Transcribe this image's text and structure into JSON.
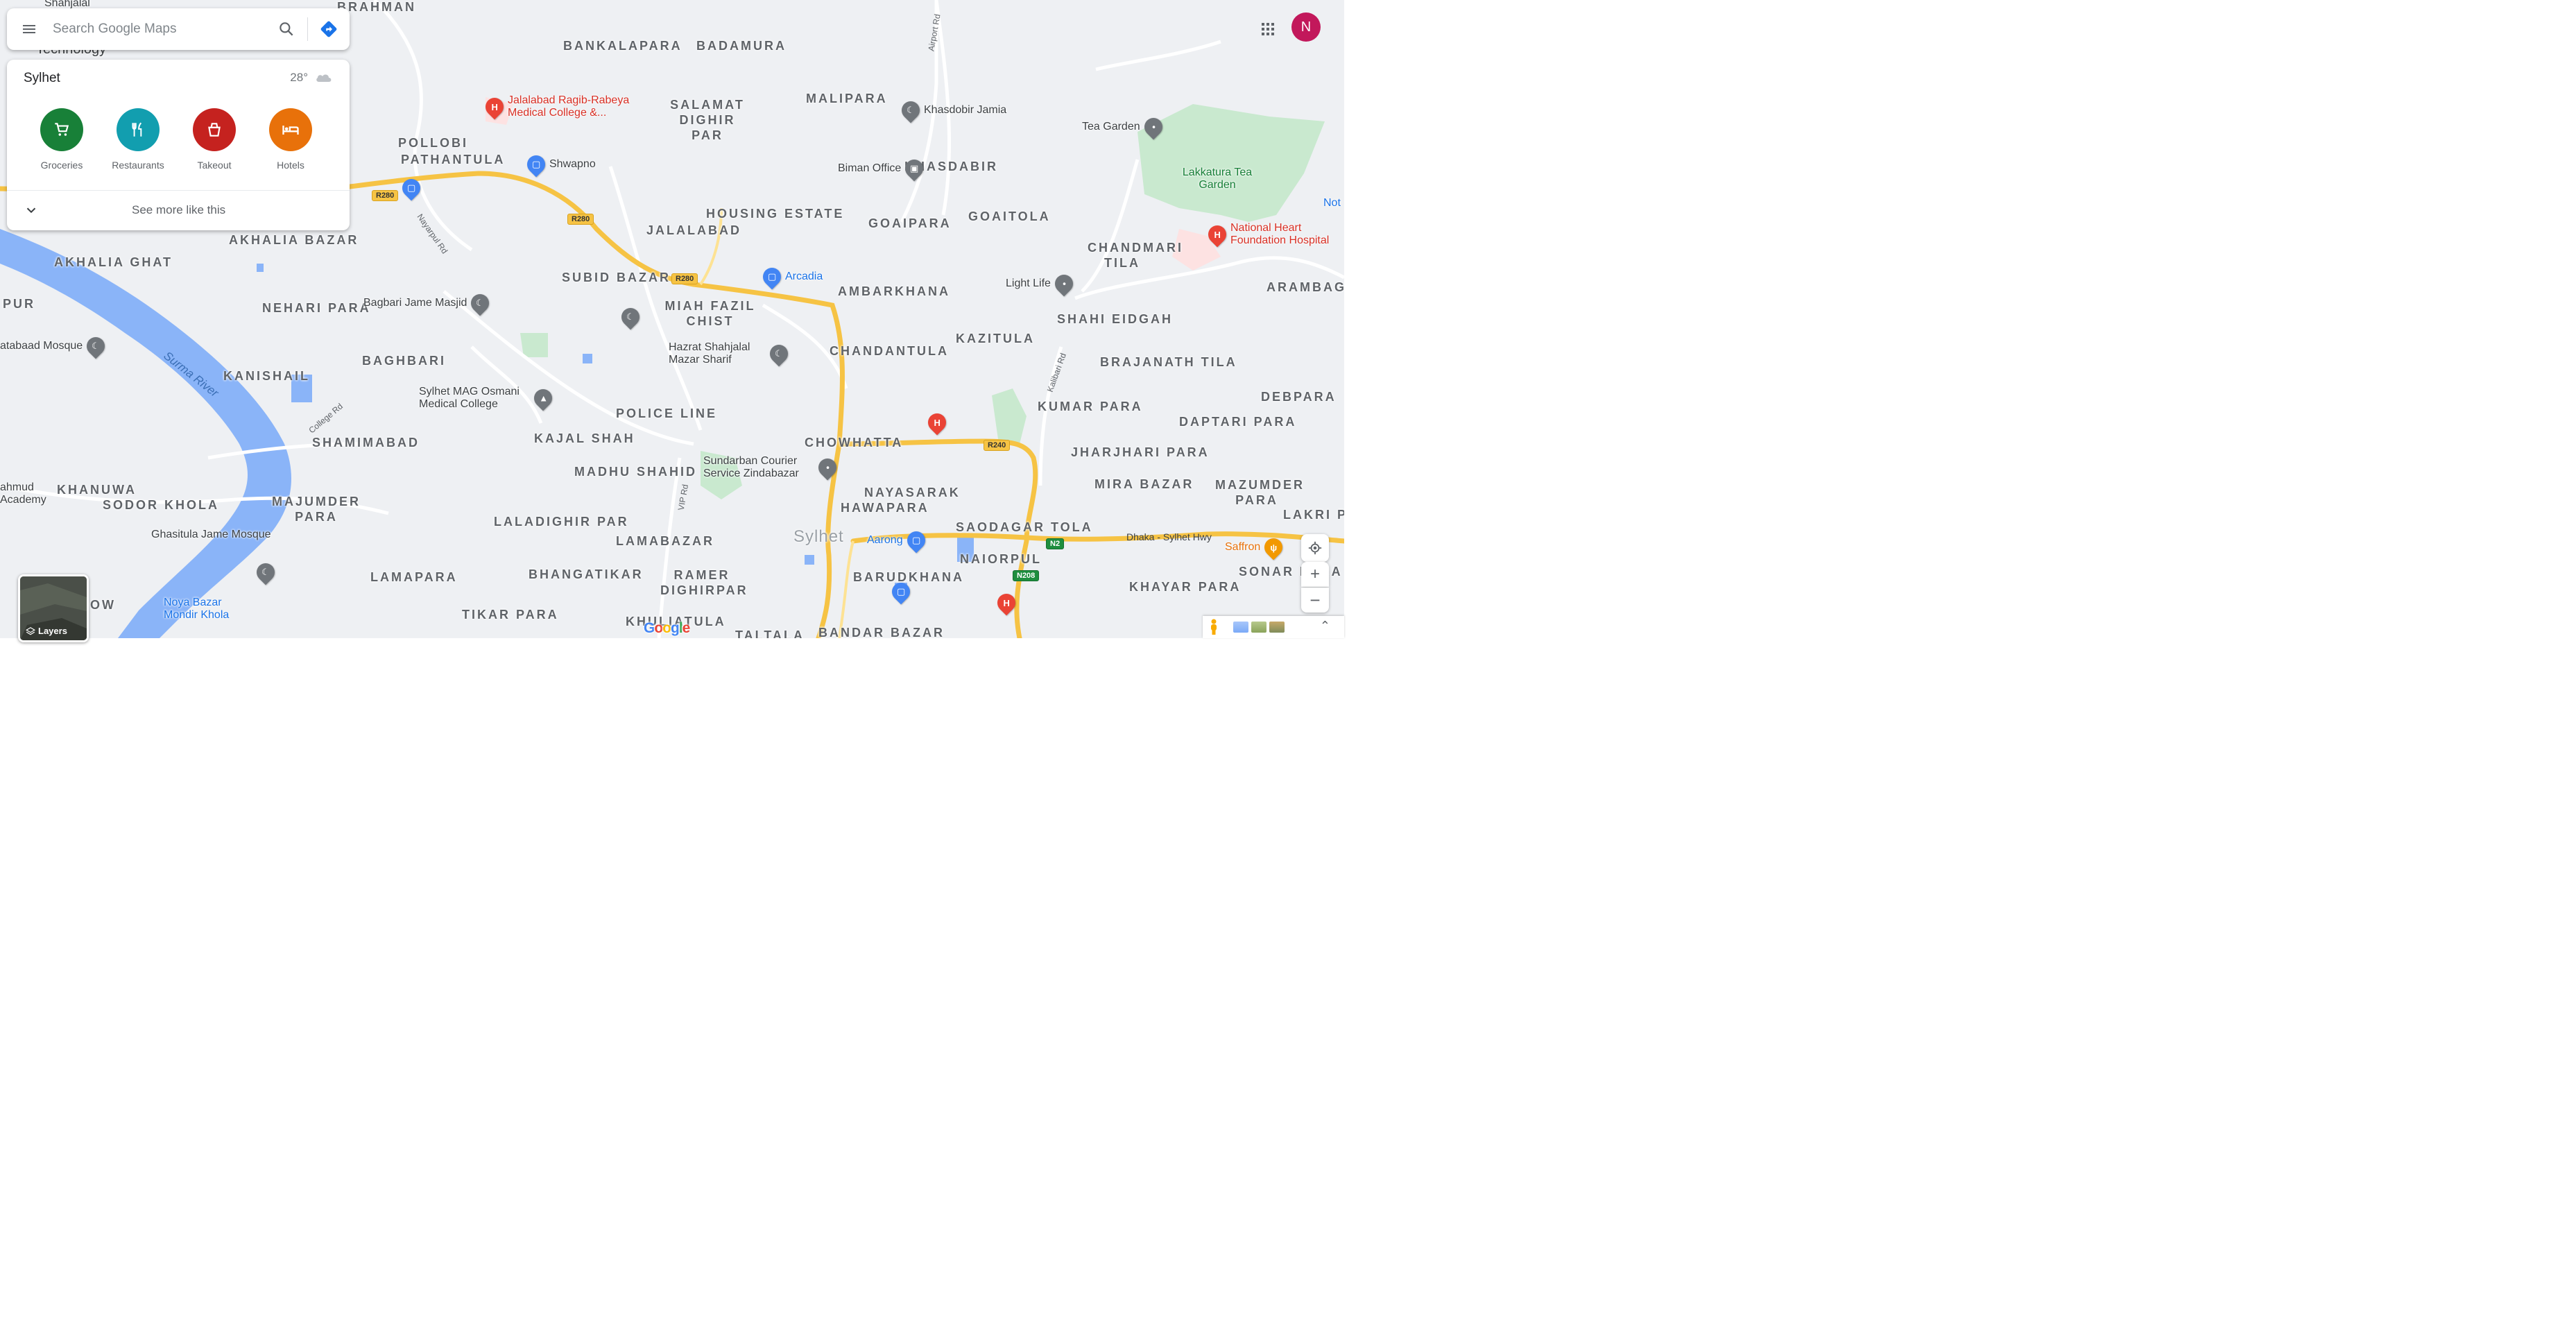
{
  "search": {
    "placeholder": "Search Google Maps"
  },
  "card": {
    "title": "Sylhet",
    "temperature": "28°",
    "weather_icon": "cloud-icon",
    "categories": [
      {
        "label": "Groceries",
        "icon": "cart-icon",
        "color": "#188038"
      },
      {
        "label": "Restaurants",
        "icon": "fork-knife-icon",
        "color": "#129eaf"
      },
      {
        "label": "Takeout",
        "icon": "takeout-bag-icon",
        "color": "#c5221f"
      },
      {
        "label": "Hotels",
        "icon": "bed-icon",
        "color": "#e8710a"
      }
    ],
    "see_more": "See more like this"
  },
  "account": {
    "avatar_letter": "N",
    "avatar_color": "#c2185b"
  },
  "map": {
    "areas": [
      "Brahman",
      "Bankalapara",
      "Badamura",
      "Salamat Dighir Par",
      "Malipara",
      "Pollobi",
      "Pathantula",
      "Khasdabir",
      "Housing Estate",
      "Goaipara",
      "Goaitola",
      "Jalalabad",
      "Akhalia Ghat",
      "Akhalia Bazar",
      "Chandmari Tila",
      "Subid Bazar",
      "Miah Fazil Chist",
      "Ambarkhana",
      "Nehari Para",
      "Shahi Eidgah",
      "Arambag",
      "Kazitula",
      "Chandantula",
      "Brajanath Tila",
      "Baghbari",
      "Kanishail",
      "Debpara",
      "Police Line",
      "Kumar Para",
      "Daptari Para",
      "Shamimabad",
      "Kajal Shah",
      "Chowhatta",
      "Jharjhari Para",
      "Madhu Shahid",
      "Nayasarak",
      "Hawapara",
      "Mira Bazar",
      "Mazumder Para",
      "Khanuwa",
      "Sodor Khola",
      "Majumder Para",
      "Laladighir Par",
      "Saodagar Tola",
      "Lakri Pa",
      "Lamabazar",
      "Naiorpul",
      "Ramer Dighirpar",
      "Barudkhana",
      "Lamapara",
      "Bhangatikar",
      "Khayar Para",
      "Sonar Para",
      "Noya Bazar",
      "Rrow",
      "Tikar Para",
      "Khuliatula",
      "Taltala",
      "Bandar Bazar",
      "Pur",
      "Sylhet"
    ],
    "pois": [
      "Jalalabad Ragib-Rabeya Medical College &...",
      "Khasdobir Jamia",
      "Tea Garden",
      "Lakkatura Tea Garden",
      "National Heart Foundation Hospital",
      "Shwapno",
      "Biman Office",
      "Arcadia",
      "Light Life",
      "Bagbari Jame Masjid",
      "Hazrat Shahjalal Mazar Sharif",
      "atabaad Mosque",
      "Sylhet MAG Osmani Medical College",
      "Sundarban Courier Service Zindabazar",
      "Aarong",
      "Saffron",
      "ahmud Academy",
      "Ghasitula Jame Mosque",
      "Noya Bazar Mondir Khola",
      "Shahjalal",
      "Technology",
      "Not"
    ],
    "rivers": [
      "Surma River"
    ],
    "roads": [
      "Airport Rd",
      "Nayarpul Rd",
      "Kalibari Rd",
      "Dhaka - Sylhet Hwy",
      "VIP Rd",
      "College Rd"
    ],
    "shields": [
      "R280",
      "R280",
      "R280",
      "R240",
      "N2",
      "N208"
    ]
  },
  "controls": {
    "layers_label": "Layers",
    "zoom_in": "+",
    "zoom_out": "−",
    "expand": "⌃"
  },
  "brand": {
    "logo_text": "Google"
  }
}
